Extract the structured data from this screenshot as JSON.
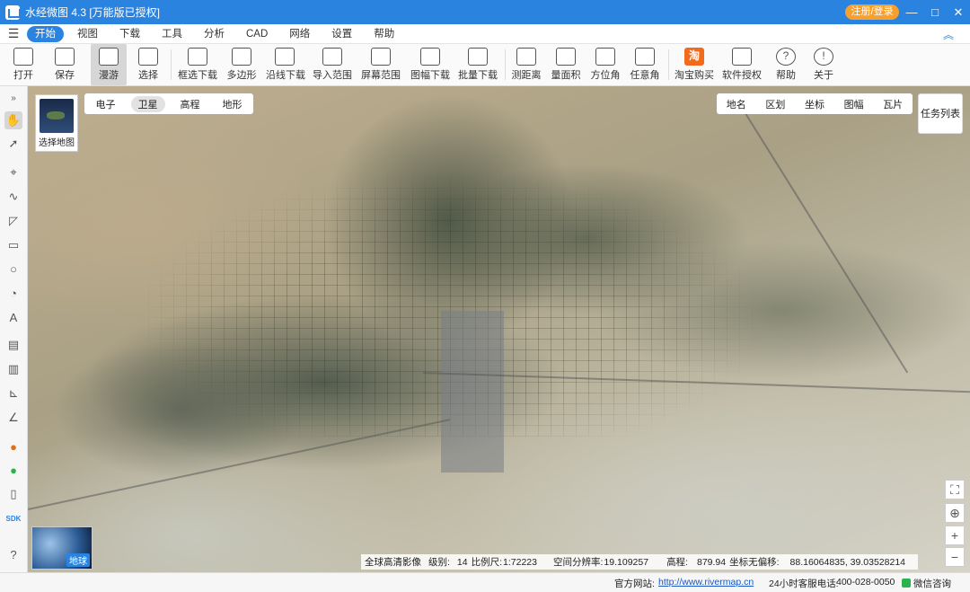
{
  "titlebar": {
    "title": "水经微图 4.3 [万能版已授权]",
    "login": "注册/登录",
    "controls": [
      "—",
      "□",
      "✕"
    ]
  },
  "menu": {
    "items": [
      "开始",
      "视图",
      "下载",
      "工具",
      "分析",
      "CAD",
      "网络",
      "设置",
      "帮助"
    ],
    "active": "开始"
  },
  "ribbon": {
    "open": "打开",
    "save": "保存",
    "pan": "漫游",
    "select": "选择",
    "box_download": "框选下载",
    "polygon": "多边形",
    "line_download": "沿线下载",
    "import_range": "导入范围",
    "screen_range": "屏幕范围",
    "sheet_download": "图幅下载",
    "batch_download": "批量下载",
    "measure_distance": "测距离",
    "measure_area": "量面积",
    "azimuth": "方位角",
    "any_angle": "任意角",
    "taobao": "淘宝购买",
    "taobao_icon": "淘",
    "license": "软件授权",
    "help": "帮助",
    "about": "关于"
  },
  "map": {
    "selector_label": "选择地图",
    "types": [
      "电子",
      "卫星",
      "高程",
      "地形"
    ],
    "active_type": "卫星",
    "overlays": [
      "地名",
      "区划",
      "坐标",
      "图幅",
      "瓦片"
    ],
    "task_list": "任务列表",
    "earth_label": "地球"
  },
  "info": {
    "source": "全球高清影像",
    "level_label": "级别:",
    "level": "14",
    "scale_label": "比例尺:",
    "scale": "1:72223",
    "resolution_label": "空间分辨率:",
    "resolution": "19.109257",
    "elevation_label": "高程:",
    "elevation": "879.94",
    "coord_label": "坐标无偏移:",
    "coords": "88.16064835, 39.03528214"
  },
  "statusbar": {
    "website_label": "官方网站:",
    "website": "http://www.rivermap.cn",
    "phone_label": "24小时客服电话:",
    "phone": "400-028-0050",
    "wechat": "微信咨询"
  },
  "colors": {
    "accent": "#2b83e0",
    "login": "#f7a02d",
    "taobao": "#f26b1d"
  }
}
